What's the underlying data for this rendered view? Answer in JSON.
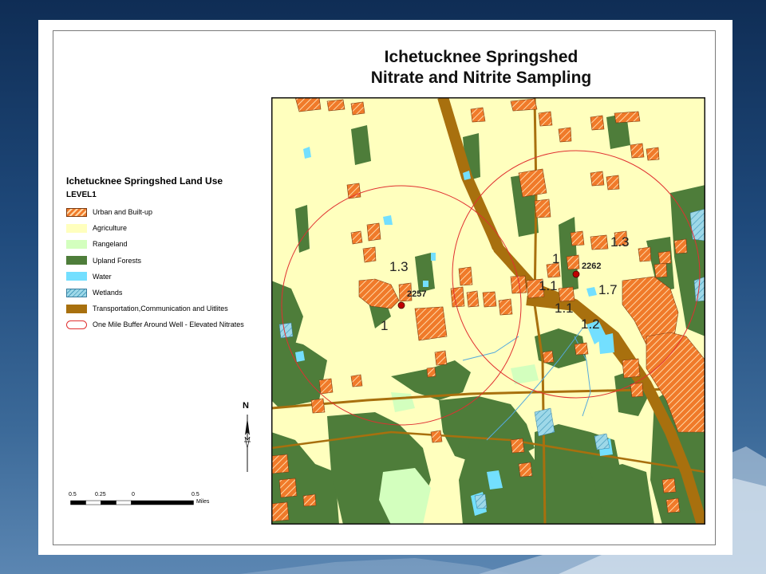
{
  "title": {
    "line1": "Ichetucknee Springshed",
    "line2": "Nitrate and Nitrite Sampling"
  },
  "legend": {
    "title": "Ichetucknee Springshed Land Use",
    "level": "LEVEL1",
    "items": [
      {
        "label": "Urban and Built-up",
        "fill": "#f07a2a",
        "pattern": "hatch"
      },
      {
        "label": "Agriculture",
        "fill": "#ffffbe",
        "pattern": "solid"
      },
      {
        "label": "Rangeland",
        "fill": "#d3ffbe",
        "pattern": "solid"
      },
      {
        "label": "Upland Forests",
        "fill": "#4e7d3a",
        "pattern": "solid"
      },
      {
        "label": "Water",
        "fill": "#73dfff",
        "pattern": "solid"
      },
      {
        "label": "Wetlands",
        "fill": "#9ed8e8",
        "pattern": "hatch-blue"
      },
      {
        "label": "Transportation,Communication and Uitlites",
        "fill": "#a8700e",
        "pattern": "solid"
      },
      {
        "label": "One Mile Buffer Around Well - Elevated Nitrates",
        "fill": "#e03030",
        "pattern": "circle"
      }
    ]
  },
  "wells": [
    {
      "id": "2257",
      "color": "#c00000"
    },
    {
      "id": "2262",
      "color": "#c00000"
    }
  ],
  "readings": [
    "1.3",
    "1",
    "1",
    "1.1",
    "1.1",
    "1.3",
    "1.7",
    "1.2"
  ],
  "north": "N",
  "scale": {
    "ticks": [
      "0.5",
      "0.25",
      "0",
      "0.5"
    ],
    "units": "Miles"
  },
  "colors": {
    "agriculture": "#ffffbe",
    "forest": "#4e7d3a",
    "urban": "#f07a2a",
    "water": "#73dfff",
    "transport": "#a8700e",
    "buffer": "#e03030"
  }
}
